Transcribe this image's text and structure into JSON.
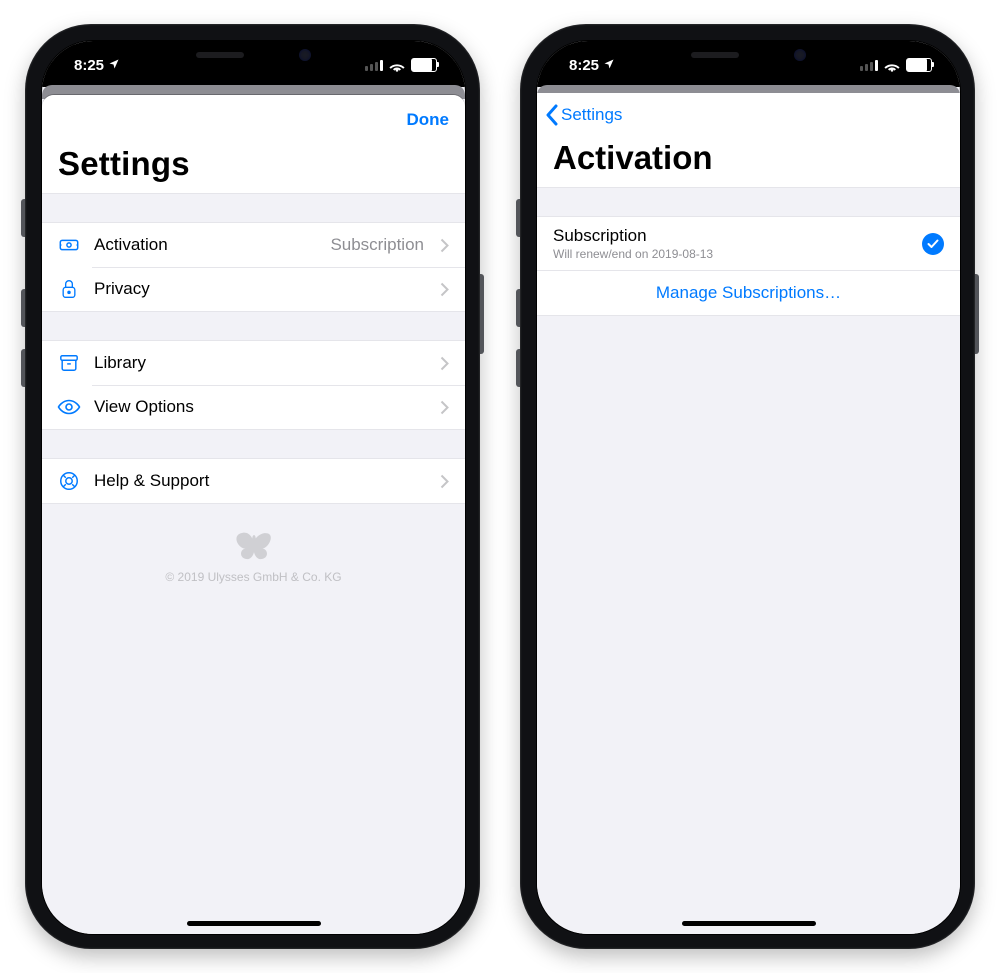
{
  "status": {
    "time": "8:25"
  },
  "left": {
    "done": "Done",
    "title": "Settings",
    "groups": [
      [
        {
          "icon": "ticket",
          "label": "Activation",
          "detail": "Subscription"
        },
        {
          "icon": "lock",
          "label": "Privacy"
        }
      ],
      [
        {
          "icon": "archive",
          "label": "Library"
        },
        {
          "icon": "eye",
          "label": "View Options"
        }
      ],
      [
        {
          "icon": "lifebuoy",
          "label": "Help & Support"
        }
      ]
    ],
    "copyright": "© 2019 Ulysses GmbH & Co. KG"
  },
  "right": {
    "back": "Settings",
    "title": "Activation",
    "subscription": {
      "title": "Subscription",
      "subtitle": "Will renew/end on 2019-08-13"
    },
    "manage": "Manage Subscriptions…"
  }
}
